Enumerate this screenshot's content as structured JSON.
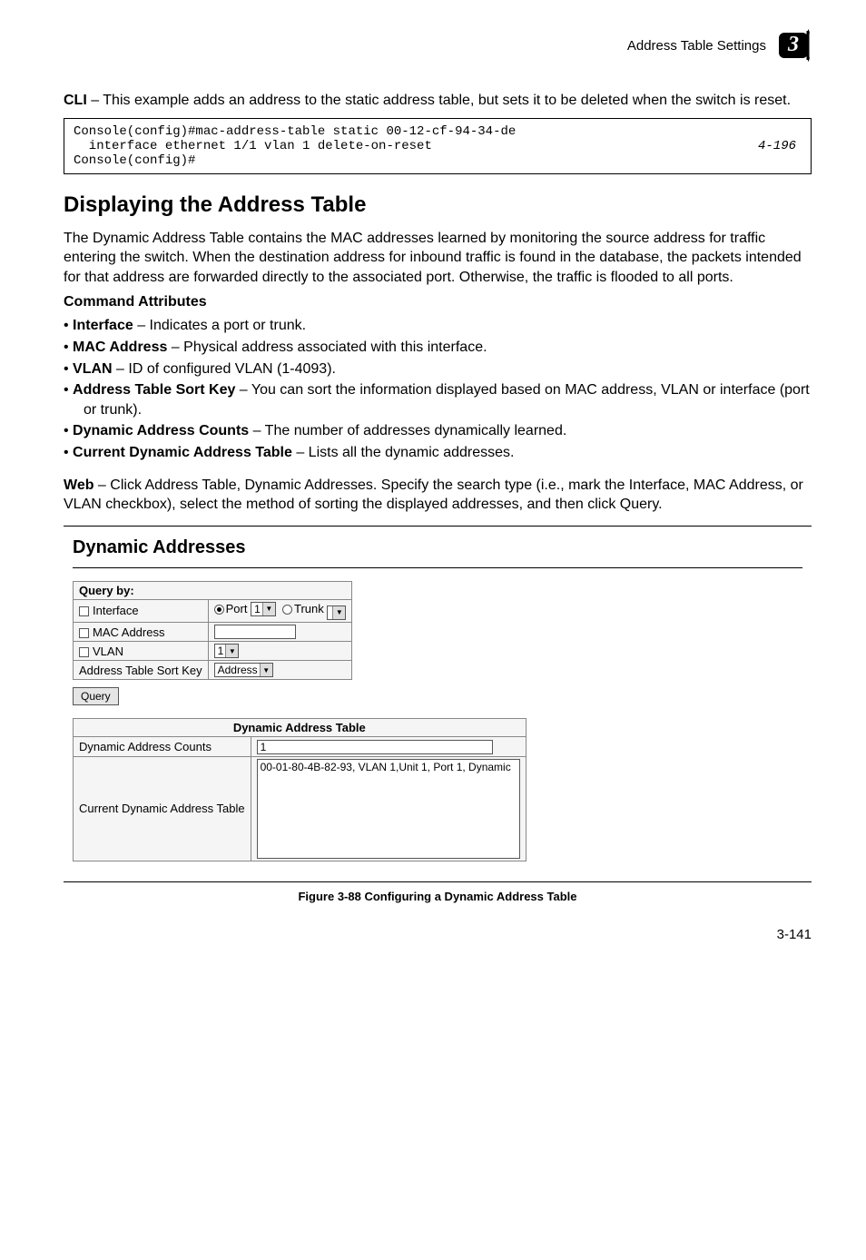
{
  "header": {
    "section": "Address Table Settings",
    "chapter": "3"
  },
  "intro": {
    "cli_label": "CLI",
    "cli_text": " – This example adds an address to the static address table, but sets it to be deleted when the switch is reset."
  },
  "code": {
    "line1": "Console(config)#mac-address-table static 00-12-cf-94-34-de",
    "line2": "  interface ethernet 1/1 vlan 1 delete-on-reset",
    "line3": "Console(config)#",
    "ref": "4-196"
  },
  "section": {
    "title": "Displaying the Address Table"
  },
  "para1": "The Dynamic Address Table contains the MAC addresses learned by monitoring the source address for traffic entering the switch. When the destination address for inbound traffic is found in the database, the packets intended for that address are forwarded directly to the associated port. Otherwise, the traffic is flooded to all ports.",
  "cmdattr": {
    "heading": "Command Attributes"
  },
  "attrs": [
    {
      "name": "Interface",
      "desc": " – Indicates a port or trunk."
    },
    {
      "name": "MAC Address",
      "desc": " – Physical address associated with this interface."
    },
    {
      "name": "VLAN",
      "desc": " – ID of configured VLAN (1-4093)."
    },
    {
      "name": "Address Table Sort Key",
      "desc": " – You can sort the information displayed based on MAC address, VLAN or interface (port or trunk)."
    },
    {
      "name": "Dynamic Address Counts",
      "desc": " – The number of addresses dynamically learned."
    },
    {
      "name": "Current Dynamic Address Table",
      "desc": " – Lists all the dynamic addresses."
    }
  ],
  "web": {
    "label": "Web",
    "text": " – Click Address Table, Dynamic Addresses. Specify the search type (i.e., mark the Interface, MAC Address, or VLAN checkbox), select the method of sorting the displayed addresses, and then click Query."
  },
  "figure": {
    "title": "Dynamic Addresses",
    "query_by": "Query by:",
    "row_interface": "Interface",
    "port_label": "Port",
    "port_value": "1",
    "trunk_label": "Trunk",
    "trunk_value": "",
    "row_mac": "MAC Address",
    "mac_value": "",
    "row_vlan": "VLAN",
    "vlan_value": "1",
    "row_sortkey": "Address Table Sort Key",
    "sortkey_value": "Address",
    "query_btn": "Query",
    "dat_header": "Dynamic Address Table",
    "counts_label": "Dynamic Address Counts",
    "counts_value": "1",
    "current_label": "Current Dynamic Address Table",
    "list_entry": "00-01-80-4B-82-93, VLAN 1,Unit 1, Port 1, Dynamic",
    "caption": "Figure 3-88  Configuring a Dynamic Address Table"
  },
  "page": "3-141"
}
